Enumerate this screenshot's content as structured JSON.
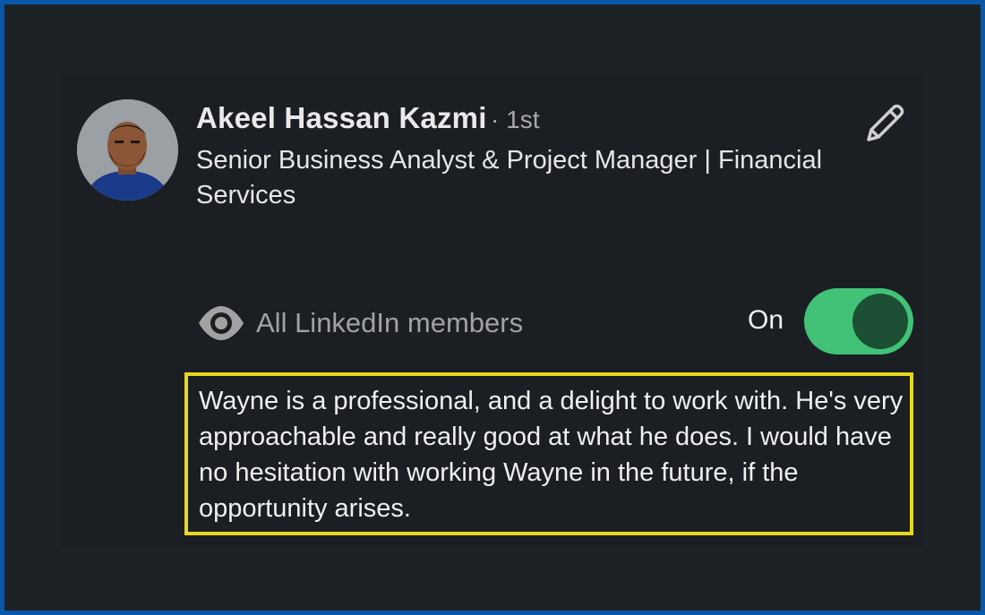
{
  "profile": {
    "name": "Akeel Hassan Kazmi",
    "degree": "· 1st",
    "headline": "Senior Business Analyst & Project Manager | Financial Services",
    "avatar_icon": "profile-photo"
  },
  "visibility": {
    "icon": "eye-icon",
    "label": "All LinkedIn members",
    "toggle_label": "On",
    "toggle_state": true
  },
  "recommendation": {
    "text": "Wayne is a professional, and a delight to work with. He's very approachable and really good at what he does. I would have no hesitation with working Wayne in the future, if the opportunity arises."
  },
  "colors": {
    "background": "#1d2226",
    "frame_border": "#0a56a8",
    "toggle_on": "#41c277",
    "highlight": "#e5d820"
  }
}
